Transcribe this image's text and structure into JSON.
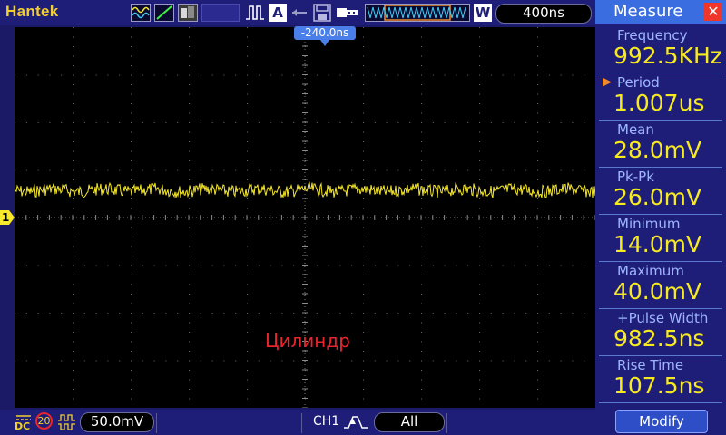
{
  "brand": "Hantek",
  "toolbar": {
    "acquire_mode_letter": "A",
    "wave_mode_letter": "W",
    "timebase": "400ns"
  },
  "screen": {
    "trigger_position": "-240.0ns",
    "channel_marker": "1",
    "overlay_text": "Цилиндр",
    "trace_color": "#f6e82a"
  },
  "bottom": {
    "coupling": "DC",
    "bw_limit": "20",
    "volts_div": "50.0mV",
    "trigger_source": "CH1",
    "trigger_mode": "All"
  },
  "measure": {
    "title": "Measure",
    "items": [
      {
        "label": "Frequency",
        "value": "992.5KHz"
      },
      {
        "label": "Period",
        "value": "1.007us"
      },
      {
        "label": "Mean",
        "value": "28.0mV"
      },
      {
        "label": "Pk-Pk",
        "value": "26.0mV"
      },
      {
        "label": "Minimum",
        "value": "14.0mV"
      },
      {
        "label": "Maximum",
        "value": "40.0mV"
      },
      {
        "label": "+Pulse Width",
        "value": "982.5ns"
      },
      {
        "label": "Rise Time",
        "value": "107.5ns"
      }
    ],
    "modify_label": "Modify"
  },
  "colors": {
    "accent": "#3a6ee0",
    "measure_value": "#f7ea1f",
    "brand": "#f2cf2e"
  }
}
